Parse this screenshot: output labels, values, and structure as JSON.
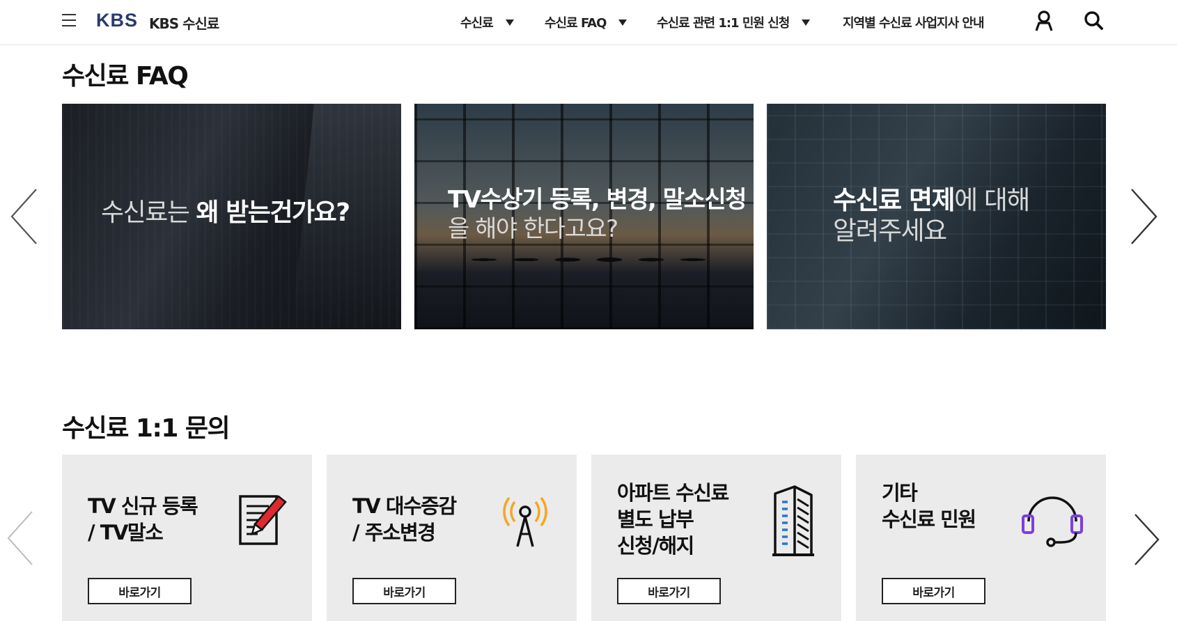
{
  "header": {
    "logo": "KBS",
    "site_name": "KBS 수신료",
    "nav": [
      {
        "label": "수신료"
      },
      {
        "label": "수신료 FAQ"
      },
      {
        "label": "수신료 관련 1:1 민원 신청"
      },
      {
        "label": "지역별 수신료 사업지사 안내"
      }
    ]
  },
  "faq": {
    "title": "수신료 FAQ",
    "cards": [
      {
        "light": "수신료는 ",
        "bold": "왜 받는건가요?"
      },
      {
        "bold": "TV수상기 등록, 변경, 말소신청",
        "light": "을 해야 한다고요?"
      },
      {
        "bold": "수신료 면제",
        "light1": "에 대해",
        "light2": "알려주세요"
      }
    ]
  },
  "inquiry": {
    "title": "수신료 1:1 문의",
    "cards": [
      {
        "line1": "TV 신규 등록",
        "line2": "/ TV말소",
        "button": "바로가기",
        "icon": "document-pencil-icon"
      },
      {
        "line1": "TV 대수증감",
        "line2": "/ 주소변경",
        "button": "바로가기",
        "icon": "antenna-tower-icon"
      },
      {
        "line1": "아파트 수신료",
        "line2": "별도 납부",
        "line3": "신청/해지",
        "button": "바로가기",
        "icon": "apartment-building-icon"
      },
      {
        "line1": "기타",
        "line2": "수신료 민원",
        "button": "바로가기",
        "icon": "headset-icon"
      }
    ]
  },
  "colors": {
    "logo": "#2c3a6e",
    "card_bg": "#ebebeb",
    "antenna_accent": "#f5a623",
    "headset_accent": "#7b3fe0",
    "pencil_accent": "#e0282e"
  }
}
